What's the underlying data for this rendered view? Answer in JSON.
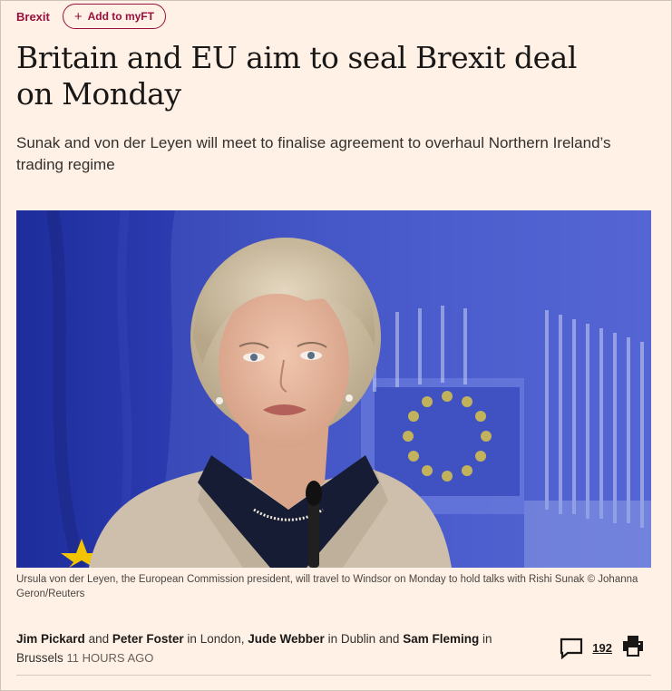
{
  "topic": {
    "label": "Brexit",
    "add_button_label": "Add to myFT"
  },
  "article": {
    "headline": "Britain and EU aim to seal Brexit deal on Monday",
    "standfirst": "Sunak and von der Leyen will meet to finalise agreement to overhaul Northern Ireland’s trading regime",
    "image": {
      "caption": "Ursula von der Leyen, the European Commission president, will travel to Windsor on Monday to hold talks with Rishi Sunak © Johanna Geron/Reuters"
    },
    "byline": {
      "authors": [
        {
          "name": "Jim Pickard"
        },
        {
          "name": "Peter Foster",
          "location_prefix": "in",
          "location": "London"
        },
        {
          "name": "Jude Webber",
          "location_prefix": "in",
          "location": "Dublin"
        },
        {
          "name": "Sam Fleming",
          "location_prefix": "in",
          "location": "Brussels"
        }
      ],
      "connector_and": "and",
      "timestamp": "11 hours ago"
    },
    "tools": {
      "comment_count": "192",
      "comment_icon": "speech-bubble-icon",
      "print_icon": "printer-icon"
    }
  },
  "colors": {
    "background": "#fff1e5",
    "brand_claret": "#990f3d",
    "text": "#33302e"
  }
}
